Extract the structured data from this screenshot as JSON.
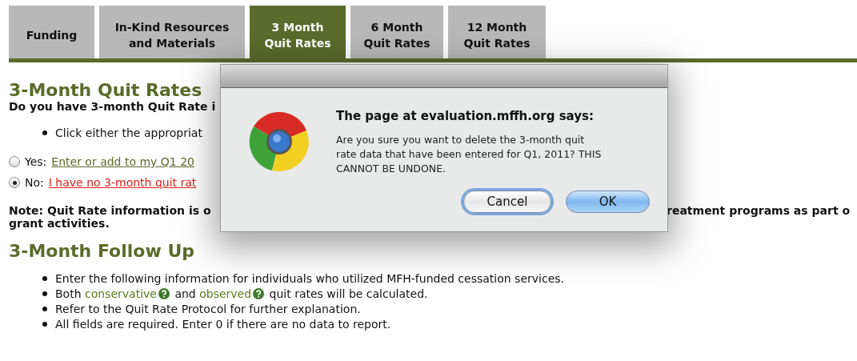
{
  "tabs": [
    {
      "label": "Funding",
      "selected": false
    },
    {
      "label": "In-Kind Resources\nand Materials",
      "selected": false
    },
    {
      "label": "3 Month\nQuit Rates",
      "selected": true
    },
    {
      "label": "6 Month\nQuit Rates",
      "selected": false
    },
    {
      "label": "12 Month\nQuit Rates",
      "selected": false
    }
  ],
  "quit_rates": {
    "heading": "3-Month Quit Rates",
    "question": "Do you have 3-month Quit Rate i",
    "bullets": [
      "Click either the appropriat"
    ],
    "options": [
      {
        "label": "Yes:",
        "link": "Enter or add to my Q1 20",
        "kind": "ok",
        "selected": false
      },
      {
        "label": "No:",
        "link": "I have no 3-month quit rat",
        "kind": "warn",
        "selected": true
      }
    ],
    "note_left": "Note: Quit Rate information is o",
    "note_right": "reatment programs as part o",
    "note_line2": "grant activities."
  },
  "follow_up": {
    "heading": "3-Month Follow Up",
    "items": [
      [
        {
          "kind": "text",
          "text": "Enter the following information for individuals who utilized MFH-funded cessation services."
        }
      ],
      [
        {
          "kind": "text",
          "text": "Both "
        },
        {
          "kind": "help_link",
          "text": "conservative"
        },
        {
          "kind": "text",
          "text": " and "
        },
        {
          "kind": "help_link",
          "text": "observed"
        },
        {
          "kind": "text",
          "text": " quit rates will be calculated."
        }
      ],
      [
        {
          "kind": "text",
          "text": "Refer to the Quit Rate Protocol for further explanation."
        }
      ],
      [
        {
          "kind": "text",
          "text": "All fields are required. Enter 0 if there are no data to report."
        }
      ]
    ]
  },
  "dialog": {
    "title": "The page at evaluation.mffh.org says:",
    "message": "Are you sure you want to delete the 3-month quit\nrate data that have been entered for Q1, 2011?  THIS\nCANNOT BE UNDONE.",
    "buttons": [
      {
        "label": "Cancel",
        "focused": true
      },
      {
        "label": "OK",
        "focused": false
      }
    ]
  }
}
